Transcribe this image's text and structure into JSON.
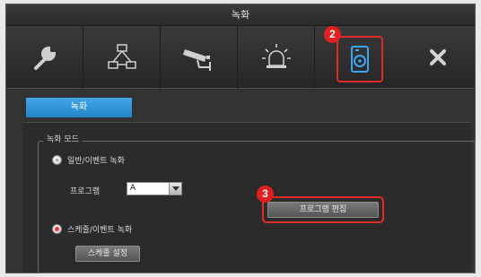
{
  "window": {
    "title": "녹화"
  },
  "toolbar": {
    "tools": [
      {
        "icon": "wrench-icon"
      },
      {
        "icon": "network-icon"
      },
      {
        "icon": "camera-icon"
      },
      {
        "icon": "alarm-icon"
      },
      {
        "icon": "storage-disk-icon"
      },
      {
        "icon": "close-icon"
      }
    ]
  },
  "tabs": {
    "record": "녹화"
  },
  "record_mode": {
    "legend": "녹화 모드",
    "option_continuous_event": "일반/이벤트 녹화",
    "program_label": "프로그램",
    "program_value": "A",
    "edit_program_button": "프로그램 편집",
    "option_schedule_event": "스케줄/이벤트 녹화",
    "schedule_button": "스케줄 설정"
  },
  "annotations": {
    "badge_2": "2",
    "badge_3": "3"
  },
  "colors": {
    "accent": "#2b8fd6",
    "highlight": "#e02a2a",
    "background": "#2e2e2e"
  }
}
